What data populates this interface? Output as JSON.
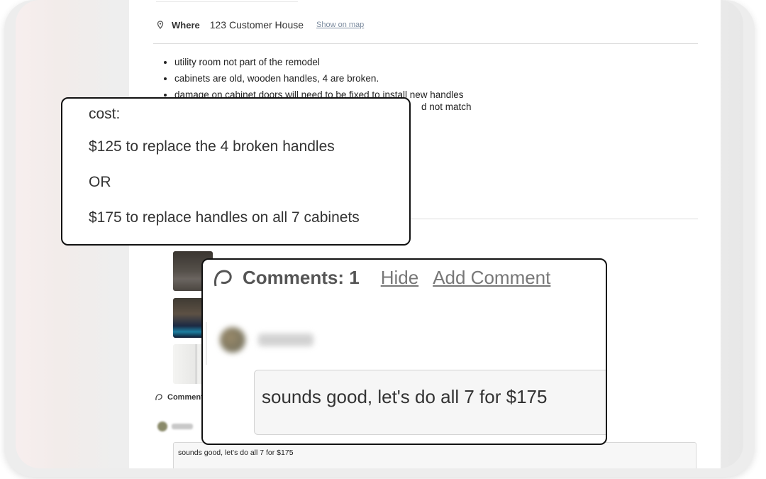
{
  "location": {
    "label": "Where",
    "address": "123 Customer House",
    "map_link": "Show on map"
  },
  "notes": [
    "utility room not part of the remodel",
    "cabinets are old, wooden handles, 4 are broken.",
    "damage on cabinet doors will need to be fixed to install new handles"
  ],
  "note_partial": "d not match",
  "cost": {
    "heading": "cost:",
    "option1": "$125 to replace the 4 broken handles",
    "or": "OR",
    "option2": "$175 to replace handles on all 7 cabinets"
  },
  "comments": {
    "small_title": "Comments",
    "title": "Comments: 1",
    "hide": "Hide",
    "add": "Add Comment",
    "reply": "sounds good, let's do all 7 for $175"
  },
  "icons": {
    "pin": "map-pin-icon",
    "comment": "comment-bubble-icon"
  }
}
